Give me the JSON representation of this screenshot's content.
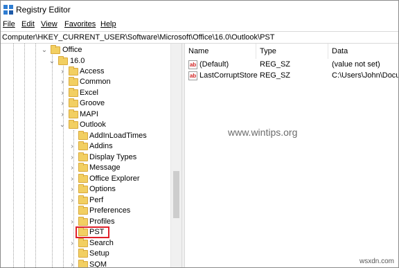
{
  "window": {
    "title": "Registry Editor"
  },
  "menu": {
    "items": [
      "File",
      "Edit",
      "View",
      "Favorites",
      "Help"
    ]
  },
  "address": {
    "path": "Computer\\HKEY_CURRENT_USER\\Software\\Microsoft\\Office\\16.0\\Outlook\\PST"
  },
  "tree": {
    "office": "Office",
    "v16": "16.0",
    "access": "Access",
    "common": "Common",
    "excel": "Excel",
    "groove": "Groove",
    "mapi": "MAPI",
    "outlook": "Outlook",
    "addinloadtimes": "AddInLoadTimes",
    "addins": "Addins",
    "displaytypes": "Display Types",
    "message": "Message",
    "officeexplorer": "Office Explorer",
    "options": "Options",
    "perf": "Perf",
    "preferences": "Preferences",
    "profiles": "Profiles",
    "pst": "PST",
    "search": "Search",
    "setup": "Setup",
    "sqm": "SQM"
  },
  "list": {
    "headers": {
      "name": "Name",
      "type": "Type",
      "data": "Data"
    },
    "rows": [
      {
        "icon": "ab",
        "name": "(Default)",
        "type": "REG_SZ",
        "data": "(value not set)"
      },
      {
        "icon": "ab",
        "name": "LastCorruptStore",
        "type": "REG_SZ",
        "data": "C:\\Users\\John\\Docum"
      }
    ]
  },
  "watermark": "www.wintips.org",
  "corner_mark": "wsxdn.com",
  "colors": {
    "folder": "#f2cf62",
    "highlight_box": "#e0202a",
    "reg_icon_text": "#d02020"
  },
  "icons": {
    "app": "registry-editor-icon",
    "expanded": "chevron-down-icon",
    "collapsed": "chevron-right-icon",
    "folder": "folder-icon",
    "value": "string-value-icon"
  }
}
